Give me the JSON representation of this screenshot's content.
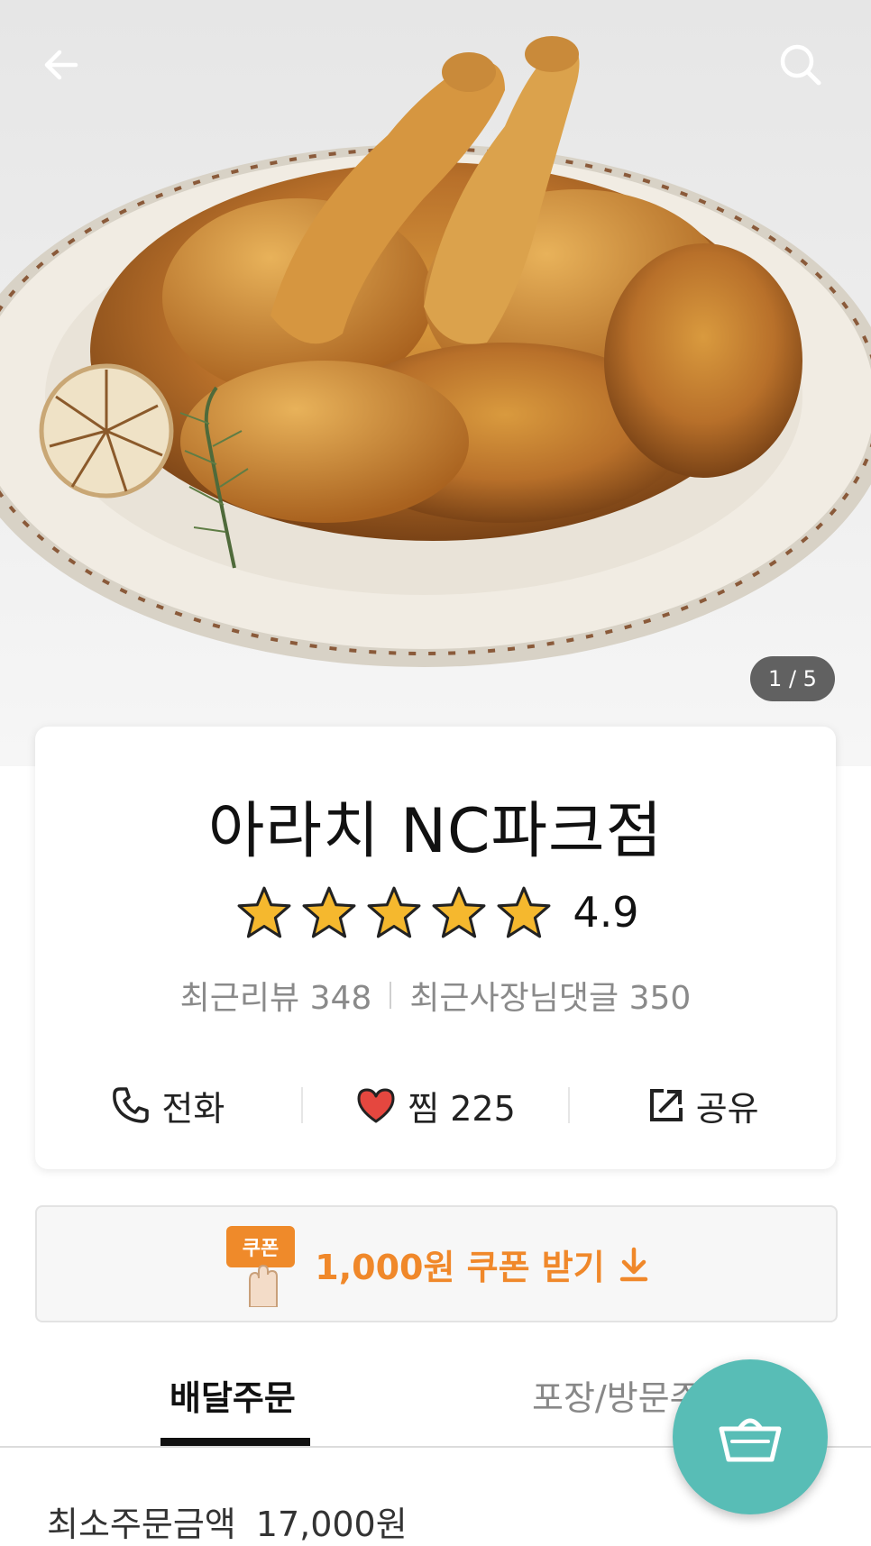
{
  "hero": {
    "image_counter": "1 / 5",
    "back_icon": "arrow-left-icon",
    "search_icon": "search-icon"
  },
  "store": {
    "name": "아라치 NC파크점",
    "rating": "4.9",
    "stars": 5,
    "recent_reviews": "최근리뷰 348",
    "recent_owner_replies": "최근사장님댓글 350"
  },
  "actions": {
    "call_label": "전화",
    "like_label": "찜 225",
    "share_label": "공유"
  },
  "coupon": {
    "badge": "쿠폰",
    "label": "1,000원 쿠폰 받기"
  },
  "tabs": {
    "delivery": "배달주문",
    "pickup": "포장/방문주"
  },
  "order": {
    "min_label": "최소주문금액",
    "min_amount": "17,000원"
  },
  "colors": {
    "accent_coupon": "#f0882a",
    "cart_button": "#58bdb6",
    "star": "#f5b82e",
    "heart": "#e5473f"
  }
}
